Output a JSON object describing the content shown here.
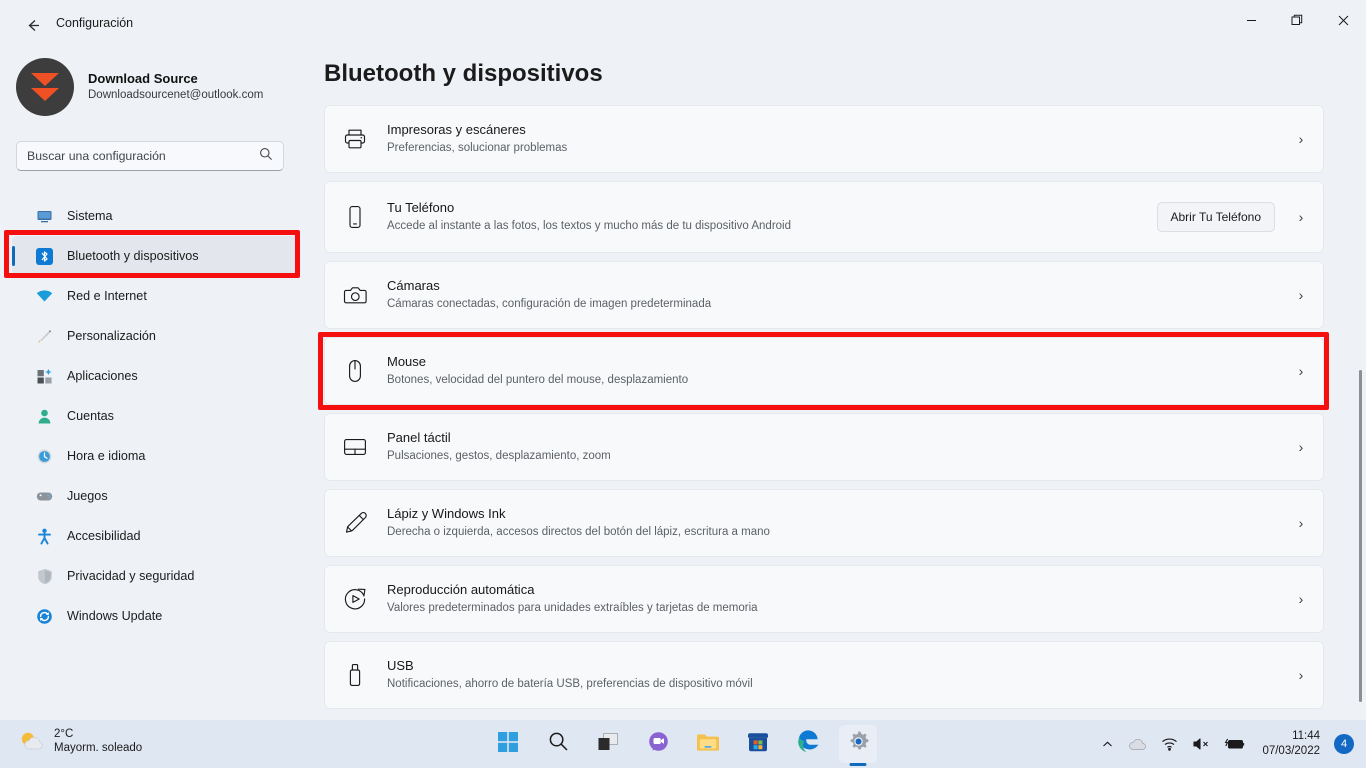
{
  "window": {
    "title": "Configuración",
    "back_icon": "back-arrow-icon",
    "minimize_label": "—",
    "restore_label": "❐",
    "close_label": "✕"
  },
  "account": {
    "name": "Download Source",
    "email": "Downloadsourcenet@outlook.com",
    "avatar_icon": "chevron-logo-avatar"
  },
  "search": {
    "placeholder": "Buscar una configuración",
    "icon": "search-icon"
  },
  "sidebar": {
    "items": [
      {
        "label": "Sistema",
        "icon": "monitor-icon",
        "selected": false
      },
      {
        "label": "Bluetooth y dispositivos",
        "icon": "bluetooth-icon",
        "selected": true
      },
      {
        "label": "Red e Internet",
        "icon": "wifi-icon",
        "selected": false
      },
      {
        "label": "Personalización",
        "icon": "paintbrush-icon",
        "selected": false
      },
      {
        "label": "Aplicaciones",
        "icon": "apps-icon",
        "selected": false
      },
      {
        "label": "Cuentas",
        "icon": "person-icon",
        "selected": false
      },
      {
        "label": "Hora e idioma",
        "icon": "clock-icon",
        "selected": false
      },
      {
        "label": "Juegos",
        "icon": "gamepad-icon",
        "selected": false
      },
      {
        "label": "Accesibilidad",
        "icon": "accessibility-icon",
        "selected": false
      },
      {
        "label": "Privacidad y seguridad",
        "icon": "shield-icon",
        "selected": false
      },
      {
        "label": "Windows Update",
        "icon": "update-icon",
        "selected": false
      }
    ]
  },
  "main": {
    "title": "Bluetooth y dispositivos",
    "chevron": "›",
    "cards": [
      {
        "title": "Impresoras y escáneres",
        "subtitle": "Preferencias, solucionar problemas",
        "icon": "printer-icon",
        "button": null,
        "highlighted": false
      },
      {
        "title": "Tu Teléfono",
        "subtitle": "Accede al instante a las fotos, los textos y mucho más de tu dispositivo Android",
        "icon": "phone-icon",
        "button": "Abrir Tu Teléfono",
        "highlighted": false
      },
      {
        "title": "Cámaras",
        "subtitle": "Cámaras conectadas, configuración de imagen predeterminada",
        "icon": "camera-icon",
        "button": null,
        "highlighted": false
      },
      {
        "title": "Mouse",
        "subtitle": "Botones, velocidad del puntero del mouse, desplazamiento",
        "icon": "mouse-icon",
        "button": null,
        "highlighted": true
      },
      {
        "title": "Panel táctil",
        "subtitle": "Pulsaciones, gestos, desplazamiento, zoom",
        "icon": "touchpad-icon",
        "button": null,
        "highlighted": false
      },
      {
        "title": "Lápiz y Windows Ink",
        "subtitle": "Derecha o izquierda, accesos directos del botón del lápiz, escritura a mano",
        "icon": "pen-icon",
        "button": null,
        "highlighted": false
      },
      {
        "title": "Reproducción automática",
        "subtitle": "Valores predeterminados para unidades extraíbles y tarjetas de memoria",
        "icon": "autoplay-icon",
        "button": null,
        "highlighted": false
      },
      {
        "title": "USB",
        "subtitle": "Notificaciones, ahorro de batería USB, preferencias de dispositivo móvil",
        "icon": "usb-icon",
        "button": null,
        "highlighted": false
      }
    ]
  },
  "taskbar": {
    "weather": {
      "temperature": "2°C",
      "description": "Mayorm. soleado",
      "icon": "sun-cloud-icon"
    },
    "apps": [
      {
        "name": "start-button",
        "icon": "windows-logo-icon",
        "active": false
      },
      {
        "name": "search-button",
        "icon": "search-icon",
        "active": false
      },
      {
        "name": "task-view-button",
        "icon": "task-view-icon",
        "active": false
      },
      {
        "name": "chat-button",
        "icon": "chat-icon",
        "active": false
      },
      {
        "name": "file-explorer-button",
        "icon": "folder-icon",
        "active": false
      },
      {
        "name": "microsoft-store-button",
        "icon": "store-icon",
        "active": false
      },
      {
        "name": "edge-button",
        "icon": "edge-icon",
        "active": false
      },
      {
        "name": "settings-button",
        "icon": "gear-icon",
        "active": true
      }
    ],
    "tray": {
      "overflow_icon": "chevron-up-icon",
      "cloud_icon": "cloud-icon",
      "wifi_icon": "wifi-icon",
      "volume_icon": "volume-muted-icon",
      "battery_icon": "battery-charging-icon",
      "time": "11:44",
      "date": "07/03/2022",
      "notification_count": "4"
    }
  },
  "colors": {
    "accent": "#0f6cbd",
    "highlight": "#f60f0f",
    "page_bg": "#eef2f7",
    "card_bg": "#f8f9fb",
    "taskbar_bg": "#dfe7f3"
  }
}
